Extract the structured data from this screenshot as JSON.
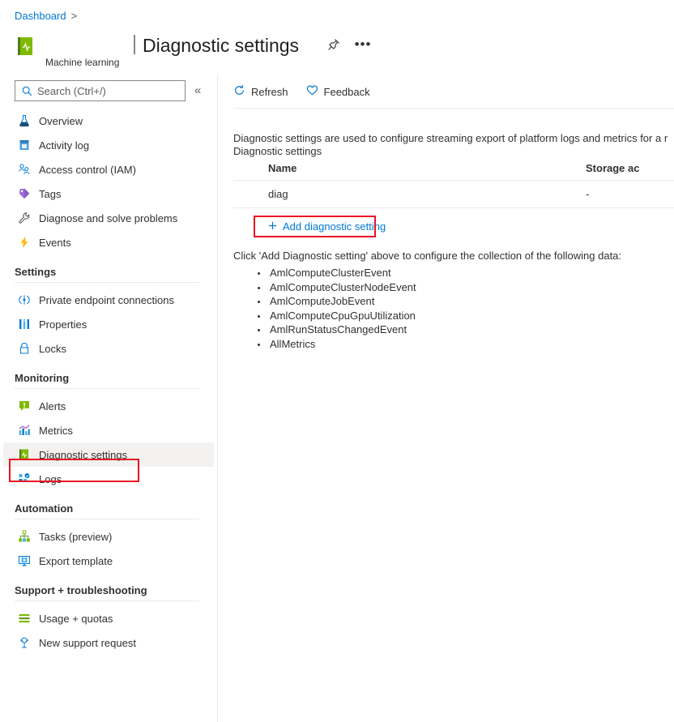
{
  "breadcrumb": {
    "items": [
      "Dashboard"
    ],
    "separator": ">"
  },
  "resource": {
    "icon": "machine-learning-icon",
    "subtitle": "Machine learning"
  },
  "header": {
    "title": "Diagnostic settings",
    "pin_icon": "pin-icon",
    "more_icon": "ellipsis-icon",
    "more_label": "•••"
  },
  "search": {
    "placeholder": "Search (Ctrl+/)",
    "value": "",
    "icon": "search-icon",
    "collapse_label": "«"
  },
  "sidebar": {
    "top_items": [
      {
        "label": "Overview",
        "icon": "overview-icon"
      },
      {
        "label": "Activity log",
        "icon": "activity-log-icon"
      },
      {
        "label": "Access control (IAM)",
        "icon": "access-control-icon"
      },
      {
        "label": "Tags",
        "icon": "tags-icon"
      },
      {
        "label": "Diagnose and solve problems",
        "icon": "wrench-icon"
      },
      {
        "label": "Events",
        "icon": "events-icon"
      }
    ],
    "groups": [
      {
        "title": "Settings",
        "items": [
          {
            "label": "Private endpoint connections",
            "icon": "private-endpoint-icon"
          },
          {
            "label": "Properties",
            "icon": "properties-icon"
          },
          {
            "label": "Locks",
            "icon": "lock-icon"
          }
        ]
      },
      {
        "title": "Monitoring",
        "items": [
          {
            "label": "Alerts",
            "icon": "alerts-icon"
          },
          {
            "label": "Metrics",
            "icon": "metrics-icon"
          },
          {
            "label": "Diagnostic settings",
            "icon": "diagnostic-settings-icon",
            "selected": true
          },
          {
            "label": "Logs",
            "icon": "logs-icon"
          }
        ]
      },
      {
        "title": "Automation",
        "items": [
          {
            "label": "Tasks (preview)",
            "icon": "tasks-icon"
          },
          {
            "label": "Export template",
            "icon": "export-template-icon"
          }
        ]
      },
      {
        "title": "Support + troubleshooting",
        "items": [
          {
            "label": "Usage + quotas",
            "icon": "usage-quotas-icon"
          },
          {
            "label": "New support request",
            "icon": "support-request-icon"
          }
        ]
      }
    ]
  },
  "main": {
    "commands": [
      {
        "label": "Refresh",
        "icon": "refresh-icon"
      },
      {
        "label": "Feedback",
        "icon": "heart-icon"
      }
    ],
    "description": "Diagnostic settings are used to configure streaming export of platform logs and metrics for a r",
    "section_label": "Diagnostic settings",
    "table": {
      "columns": [
        "Name",
        "Storage ac"
      ],
      "rows": [
        {
          "name": "diag",
          "storage_account": "-"
        }
      ]
    },
    "add_link": {
      "label": "Add diagnostic setting",
      "icon": "plus-icon"
    },
    "click_note": "Click 'Add Diagnostic setting' above to configure the collection of the following data:",
    "data_categories": [
      "AmlComputeClusterEvent",
      "AmlComputeClusterNodeEvent",
      "AmlComputeJobEvent",
      "AmlComputeCpuGpuUtilization",
      "AmlRunStatusChangedEvent",
      "AllMetrics"
    ]
  },
  "colors": {
    "accent": "#0078d4",
    "annotation": "#e81123",
    "selected_bg": "#f3f2f1"
  }
}
